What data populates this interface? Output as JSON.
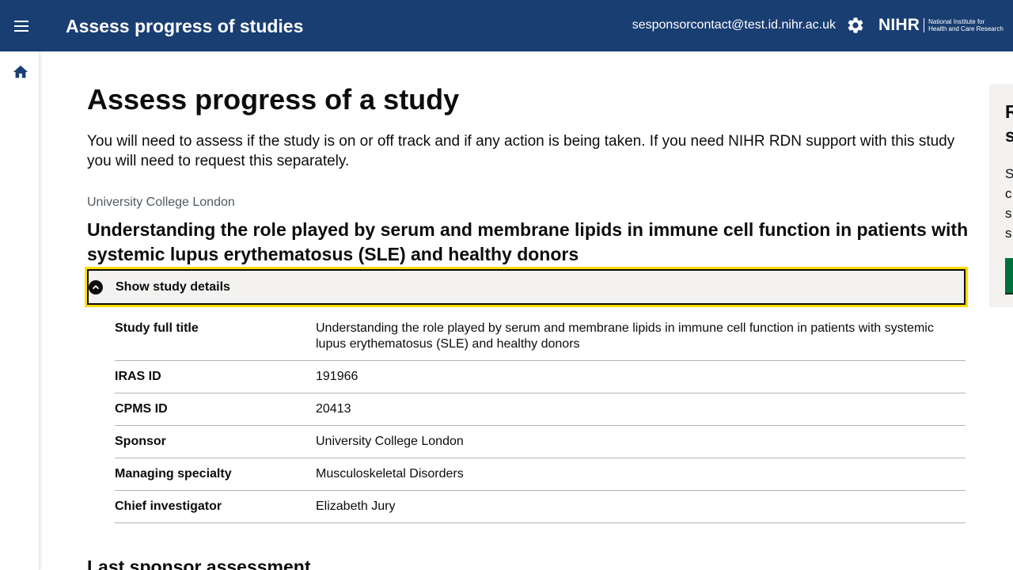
{
  "header": {
    "app_title": "Assess progress of studies",
    "user_email": "sesponsorcontact@test.id.nihr.ac.uk",
    "logo_mark": "NIHR",
    "logo_text_line1": "National Institute for",
    "logo_text_line2": "Health and Care Research",
    "background": "#193e72"
  },
  "sidenav": {
    "home_icon": "home-icon"
  },
  "main": {
    "page_title": "Assess progress of a study",
    "intro": "You will need to assess if the study is on or off track and if any action is being taken. If you need NIHR RDN support with this study you will need to request this separately.",
    "sponsor_caption": "University College London",
    "study_title": "Understanding the role played by serum and membrane lipids in immune cell function in patients with systemic lupus erythematosus (SLE) and healthy donors",
    "details": {
      "summary_label": "Show study details",
      "rows": [
        {
          "key": "Study full title",
          "value": "Understanding the role played by serum and membrane lipids in immune cell function in patients with systemic lupus erythematosus (SLE) and healthy donors"
        },
        {
          "key": "IRAS ID",
          "value": "191966"
        },
        {
          "key": "CPMS ID",
          "value": "20413"
        },
        {
          "key": "Sponsor",
          "value": "University College London"
        },
        {
          "key": "Managing specialty",
          "value": "Musculoskeletal Disorders"
        },
        {
          "key": "Chief investigator",
          "value": "Elizabeth Jury"
        }
      ]
    },
    "next_section_heading": "Last sponsor assessment"
  },
  "side_panel": {
    "heading_partial": "R\ns",
    "text_partial": "S\nc\ns\ns",
    "button_color": "#00703c"
  },
  "colors": {
    "focus": "#ffdd00",
    "summary_background": "#f3f2f1",
    "caption": "#505a5f",
    "divider": "#b1b4b6"
  }
}
